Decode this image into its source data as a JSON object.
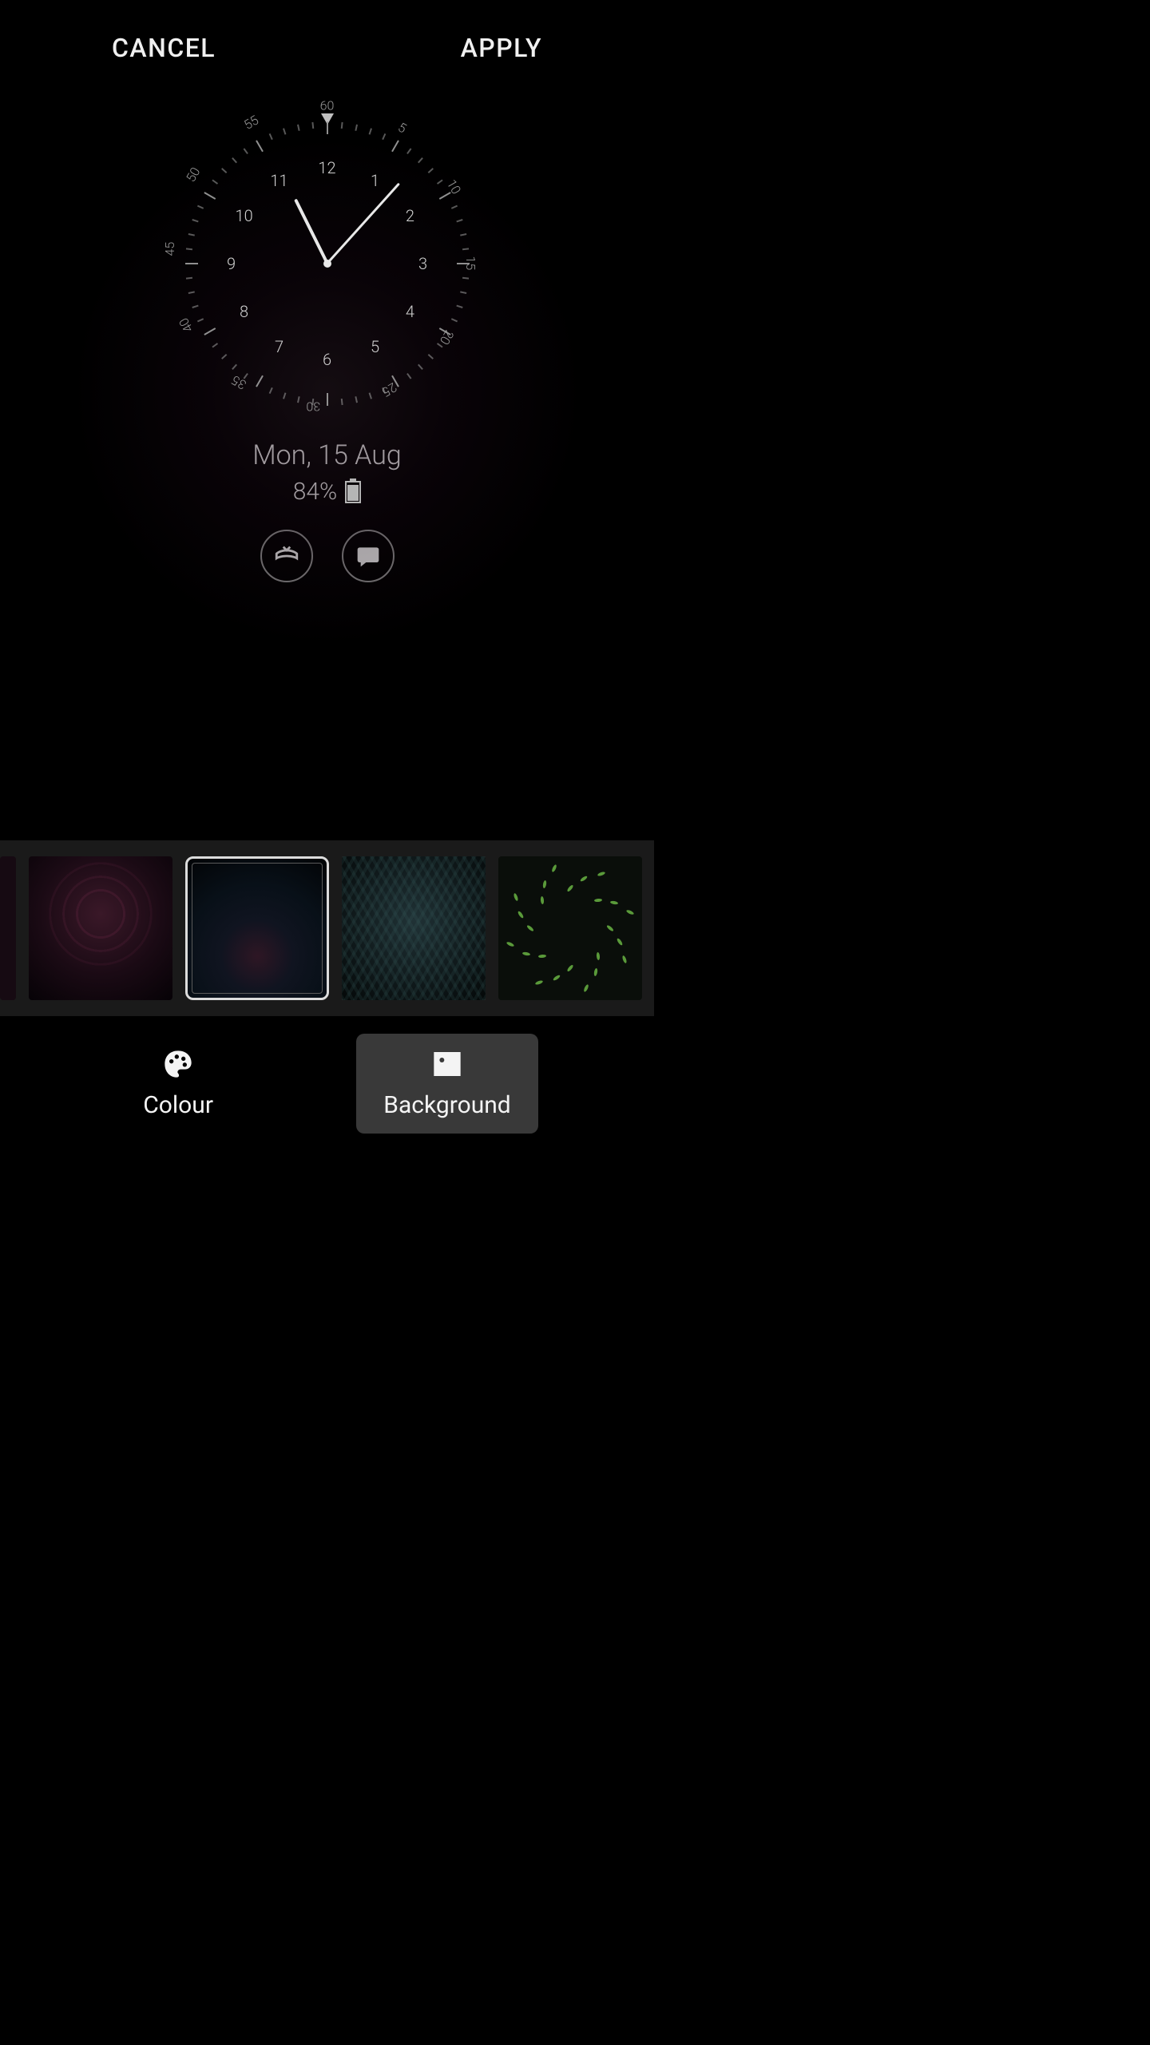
{
  "topbar": {
    "cancel": "CANCEL",
    "apply": "APPLY"
  },
  "clock": {
    "hour": 11,
    "minute": 7,
    "hour_numbers": [
      "12",
      "1",
      "2",
      "3",
      "4",
      "5",
      "6",
      "7",
      "8",
      "9",
      "10",
      "11"
    ],
    "minute_numbers": [
      "60",
      "5",
      "10",
      "15",
      "20",
      "25",
      "30",
      "35",
      "40",
      "45",
      "50",
      "55"
    ]
  },
  "info": {
    "date": "Mon, 15 Aug",
    "battery_pct": "84%"
  },
  "icons": {
    "missed_call": "missed-call-icon",
    "message": "message-icon",
    "palette": "palette-icon",
    "image": "image-icon",
    "battery": "battery-icon"
  },
  "thumbnails": [
    {
      "id": "bg-partial",
      "selected": false,
      "style": "thumb0",
      "desc": "dark-crop"
    },
    {
      "id": "bg-magenta-lace",
      "selected": false,
      "style": "thumb1",
      "desc": "magenta-floral-pattern"
    },
    {
      "id": "bg-dark-gradient",
      "selected": true,
      "style": "thumb2",
      "desc": "dark-dotted-gradient"
    },
    {
      "id": "bg-teal-hex",
      "selected": false,
      "style": "thumb3",
      "desc": "teal-hexagon-weave"
    },
    {
      "id": "bg-green-leaves",
      "selected": false,
      "style": "thumb4",
      "desc": "green-leaf-ring"
    }
  ],
  "bottom": {
    "colour": "Colour",
    "background": "Background",
    "active": "background"
  }
}
